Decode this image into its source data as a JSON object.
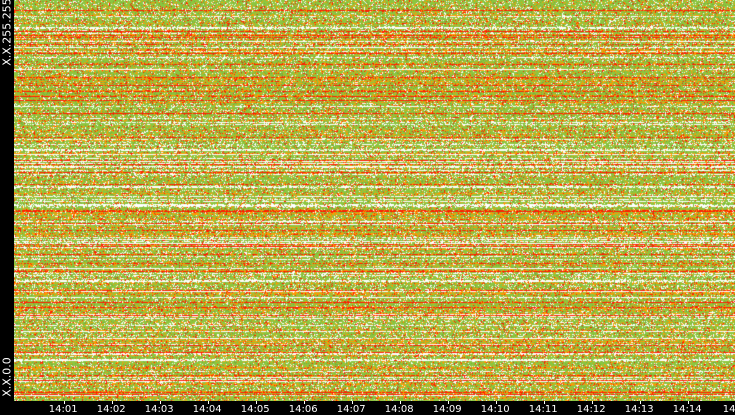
{
  "y_axis": {
    "top_label": "X.X.255.255",
    "bottom_label": "X.X.0.0"
  },
  "x_axis": {
    "tick_labels": [
      "14:01",
      "14:02",
      "14:03",
      "14:04",
      "14:05",
      "14:06",
      "14:07",
      "14:08",
      "14:09",
      "14:10",
      "14:11",
      "14:12",
      "14:13",
      "14:14",
      "14"
    ]
  },
  "colors": {
    "background": "#000000",
    "empty": "#ffffff",
    "low": "#8cc63f",
    "medium": "#ff9900",
    "high": "#ff1a00",
    "axis_text": "#ffffff"
  },
  "chart_data": {
    "type": "heatmap",
    "title": "",
    "xlabel": "",
    "ylabel": "",
    "x_categories": [
      "14:01",
      "14:02",
      "14:03",
      "14:04",
      "14:05",
      "14:06",
      "14:07",
      "14:08",
      "14:09",
      "14:10",
      "14:11",
      "14:12",
      "14:13",
      "14:14",
      "14"
    ],
    "y_range": [
      "X.X.0.0",
      "X.X.255.255"
    ],
    "color_scale": [
      "#ffffff",
      "#8cc63f",
      "#ff9900",
      "#ff1a00"
    ],
    "grid": false
  }
}
